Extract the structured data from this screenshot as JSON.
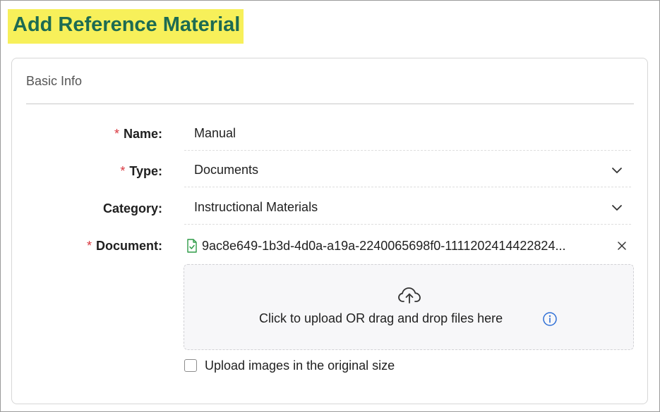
{
  "page": {
    "title": "Add Reference Material"
  },
  "basic_info": {
    "header": "Basic Info",
    "required_marker": "*",
    "name": {
      "label": "Name:",
      "value": "Manual"
    },
    "type": {
      "label": "Type:",
      "value": "Documents"
    },
    "category": {
      "label": "Category:",
      "value": "Instructional Materials"
    },
    "document": {
      "label": "Document:",
      "file_name": "9ac8e649-1b3d-4d0a-a19a-2240065698f0-1111202414422824..."
    },
    "dropzone": {
      "text": "Click to upload OR drag and drop files here"
    },
    "original_size_checkbox": {
      "label": "Upload images in the original size",
      "checked": false
    }
  },
  "icons": {
    "chevron": "chevron-down-icon",
    "file_check": "file-check-icon",
    "close": "close-icon",
    "upload": "cloud-upload-icon",
    "info": "info-icon"
  },
  "colors": {
    "title_highlight": "#f7f05a",
    "title_text": "#1d6b52",
    "required": "#d9363e",
    "file_icon": "#2e9b47",
    "info_icon": "#2f6fd6"
  }
}
